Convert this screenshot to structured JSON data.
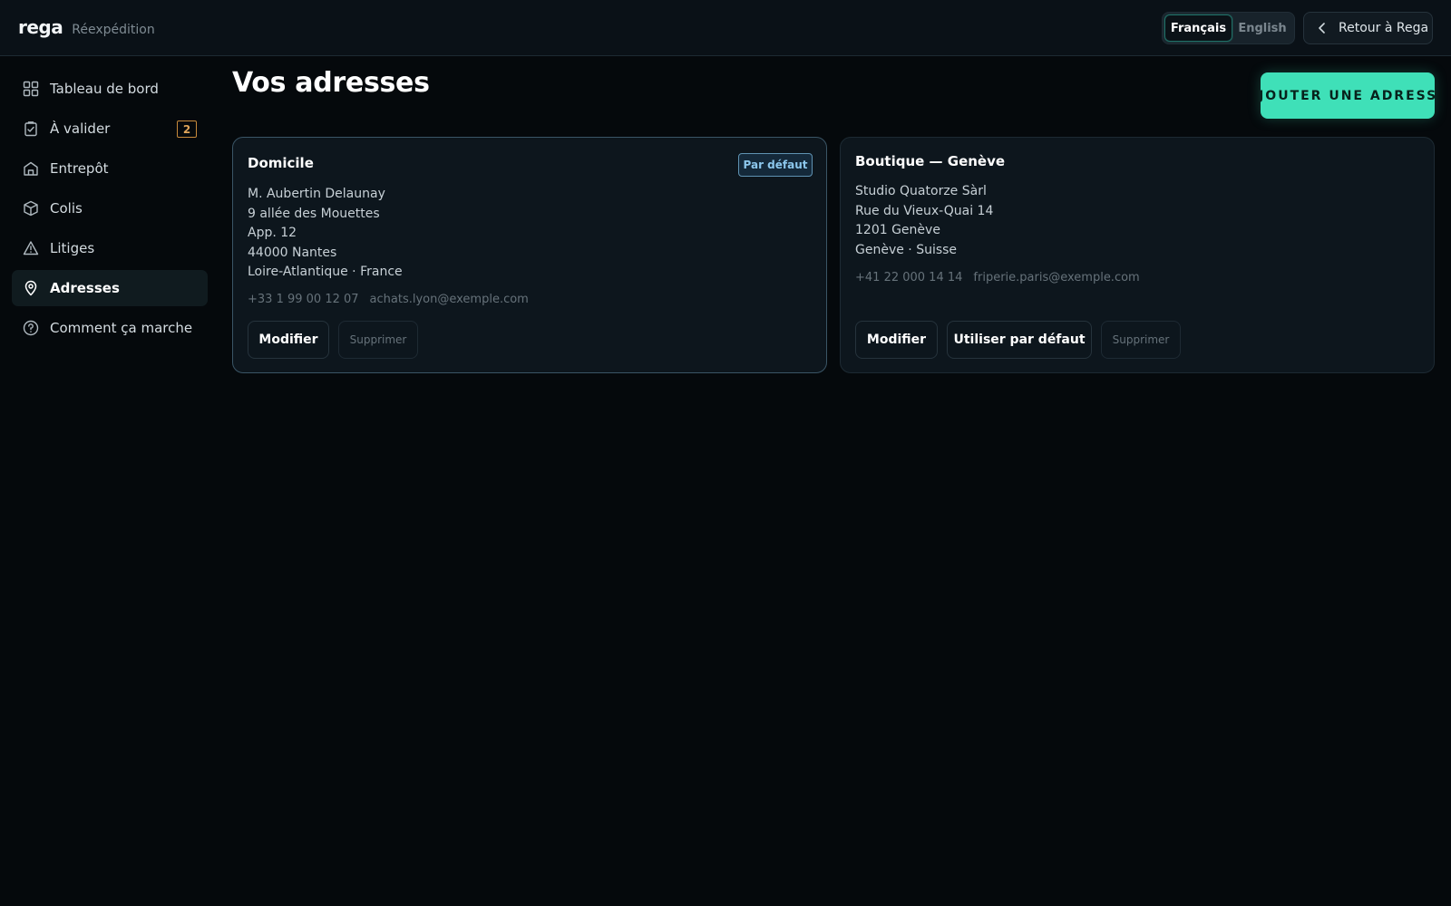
{
  "brand": {
    "logo": "rega",
    "subtitle": "Réexpédition"
  },
  "language": {
    "active": "Français",
    "inactive": "English"
  },
  "back_button": {
    "label": "Retour à Rega",
    "icon": "chevron-left-icon"
  },
  "sidebar": {
    "items": [
      {
        "label": "Tableau de bord",
        "icon": "grid-icon"
      },
      {
        "label": "À valider",
        "icon": "clipboard-check-icon",
        "badge": "2"
      },
      {
        "label": "Entrepôt",
        "icon": "warehouse-icon"
      },
      {
        "label": "Colis",
        "icon": "package-icon"
      },
      {
        "label": "Litiges",
        "icon": "warning-icon"
      },
      {
        "label": "Adresses",
        "icon": "map-pin-icon",
        "active": true
      },
      {
        "label": "Comment ça marche",
        "icon": "help-circle-icon"
      }
    ]
  },
  "main": {
    "title": "Vos adresses",
    "add_button": "AJOUTER UNE ADRESSE",
    "addresses": [
      {
        "name": "Domicile",
        "badge": "Par défaut",
        "lines": [
          "M. Aubertin Delaunay",
          "9 allée des Mouettes",
          "App. 12",
          "44000 Nantes",
          "Loire-Atlantique · France"
        ],
        "phone": "+33 1 99 00 12 07",
        "email": "achats.lyon@exemple.com",
        "actions": {
          "edit": "Modifier",
          "delete": "Supprimer"
        }
      },
      {
        "name": "Boutique — Genève",
        "lines": [
          "Studio Quatorze Sàrl",
          "Rue du Vieux-Quai 14",
          "1201 Genève",
          "Genève · Suisse"
        ],
        "phone": "+41 22 000 14 14",
        "email": "friperie.paris@exemple.com",
        "actions": {
          "edit": "Modifier",
          "make_default": "Utiliser par défaut",
          "delete": "Supprimer"
        }
      }
    ]
  },
  "colors": {
    "accent": "#3fe0b8",
    "background": "#05090c",
    "card": "#0d161d",
    "badge_text": "#8cc7ec",
    "warning_badge": "#e0a55a"
  }
}
